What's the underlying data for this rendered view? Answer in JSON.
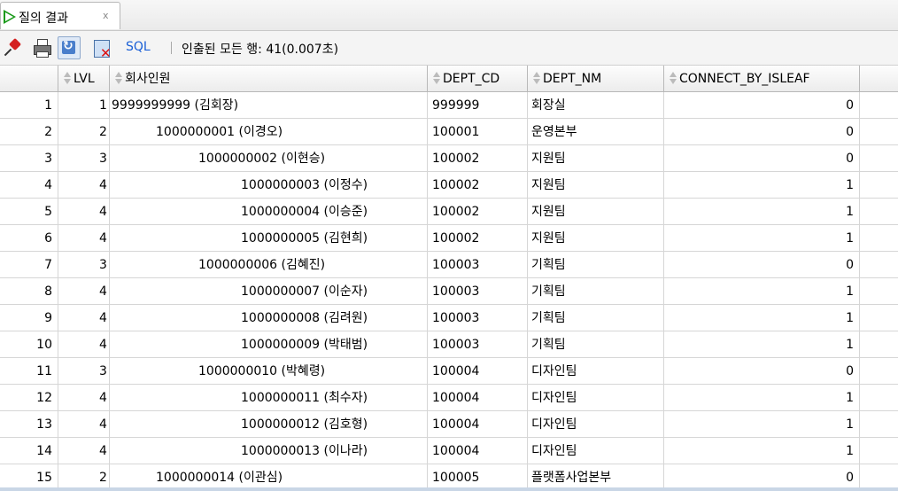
{
  "tab": {
    "label": "질의 결과",
    "close": "x"
  },
  "toolbar": {
    "sql_label": "SQL",
    "separator": "|",
    "status": "인출된 모든 행: 41(0.007초)"
  },
  "columns": [
    "LVL",
    "회사인원",
    "DEPT_CD",
    "DEPT_NM",
    "CONNECT_BY_ISLEAF"
  ],
  "rows": [
    {
      "num": "1",
      "lvl": "1",
      "emp": "9999999999 (김회장)",
      "dept_cd": "999999",
      "dept_nm": "회장실",
      "leaf": "0"
    },
    {
      "num": "2",
      "lvl": "2",
      "emp": "1000000001 (이경오)",
      "dept_cd": "100001",
      "dept_nm": "운영본부",
      "leaf": "0"
    },
    {
      "num": "3",
      "lvl": "3",
      "emp": "1000000002 (이현승)",
      "dept_cd": "100002",
      "dept_nm": "지원팀",
      "leaf": "0"
    },
    {
      "num": "4",
      "lvl": "4",
      "emp": "1000000003 (이정수)",
      "dept_cd": "100002",
      "dept_nm": "지원팀",
      "leaf": "1"
    },
    {
      "num": "5",
      "lvl": "4",
      "emp": "1000000004 (이승준)",
      "dept_cd": "100002",
      "dept_nm": "지원팀",
      "leaf": "1"
    },
    {
      "num": "6",
      "lvl": "4",
      "emp": "1000000005 (김현희)",
      "dept_cd": "100002",
      "dept_nm": "지원팀",
      "leaf": "1"
    },
    {
      "num": "7",
      "lvl": "3",
      "emp": "1000000006 (김혜진)",
      "dept_cd": "100003",
      "dept_nm": "기획팀",
      "leaf": "0"
    },
    {
      "num": "8",
      "lvl": "4",
      "emp": "1000000007 (이순자)",
      "dept_cd": "100003",
      "dept_nm": "기획팀",
      "leaf": "1"
    },
    {
      "num": "9",
      "lvl": "4",
      "emp": "1000000008 (김려원)",
      "dept_cd": "100003",
      "dept_nm": "기획팀",
      "leaf": "1"
    },
    {
      "num": "10",
      "lvl": "4",
      "emp": "1000000009 (박태범)",
      "dept_cd": "100003",
      "dept_nm": "기획팀",
      "leaf": "1"
    },
    {
      "num": "11",
      "lvl": "3",
      "emp": "1000000010 (박혜령)",
      "dept_cd": "100004",
      "dept_nm": "디자인팀",
      "leaf": "0"
    },
    {
      "num": "12",
      "lvl": "4",
      "emp": "1000000011 (최수자)",
      "dept_cd": "100004",
      "dept_nm": "디자인팀",
      "leaf": "1"
    },
    {
      "num": "13",
      "lvl": "4",
      "emp": "1000000012 (김호형)",
      "dept_cd": "100004",
      "dept_nm": "디자인팀",
      "leaf": "1"
    },
    {
      "num": "14",
      "lvl": "4",
      "emp": "1000000013 (이나라)",
      "dept_cd": "100004",
      "dept_nm": "디자인팀",
      "leaf": "1"
    },
    {
      "num": "15",
      "lvl": "2",
      "emp": "1000000014 (이관심)",
      "dept_cd": "100005",
      "dept_nm": "플랫폼사업본부",
      "leaf": "0"
    }
  ]
}
